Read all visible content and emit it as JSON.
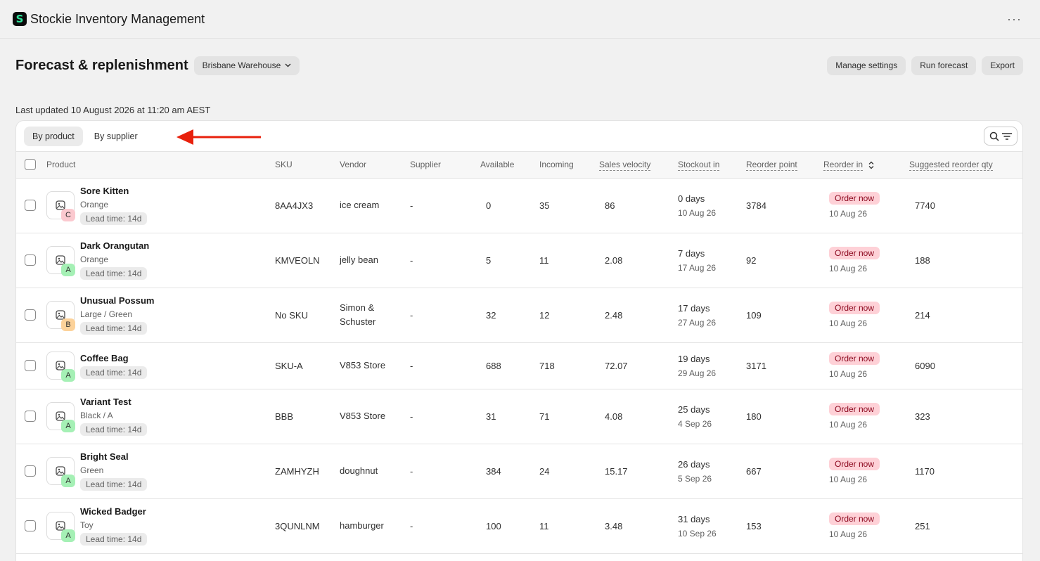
{
  "app": {
    "title": "Stockie Inventory Management",
    "logo_letter": "S",
    "more_label": "···"
  },
  "header": {
    "title": "Forecast & replenishment",
    "location": "Brisbane Warehouse",
    "actions": {
      "manage": "Manage settings",
      "run": "Run forecast",
      "export": "Export"
    }
  },
  "last_updated": "Last updated 10 August 2026 at 11:20 am AEST",
  "tabs": {
    "by_product": "By product",
    "by_supplier": "By supplier"
  },
  "columns": {
    "product": "Product",
    "sku": "SKU",
    "vendor": "Vendor",
    "supplier": "Supplier",
    "available": "Available",
    "incoming": "Incoming",
    "sales_velocity": "Sales velocity",
    "stockout_in": "Stockout in",
    "reorder_point": "Reorder point",
    "reorder_in": "Reorder in",
    "suggested_qty": "Suggested reorder qty"
  },
  "rows": [
    {
      "name": "Sore Kitten",
      "variant": "Orange",
      "lead": "Lead time: 14d",
      "grade": "C",
      "sku": "8AA4JX3",
      "vendor": "ice cream",
      "supplier": "-",
      "available": "0",
      "incoming": "35",
      "velocity": "86",
      "stockout_days": "0 days",
      "stockout_date": "10 Aug 26",
      "reorder_point": "3784",
      "reorder_badge": "Order now",
      "reorder_date": "10 Aug 26",
      "suggested": "7740"
    },
    {
      "name": "Dark Orangutan",
      "variant": "Orange",
      "lead": "Lead time: 14d",
      "grade": "A",
      "sku": "KMVEOLN",
      "vendor": "jelly bean",
      "supplier": "-",
      "available": "5",
      "incoming": "11",
      "velocity": "2.08",
      "stockout_days": "7 days",
      "stockout_date": "17 Aug 26",
      "reorder_point": "92",
      "reorder_badge": "Order now",
      "reorder_date": "10 Aug 26",
      "suggested": "188"
    },
    {
      "name": "Unusual Possum",
      "variant": "Large / Green",
      "lead": "Lead time: 14d",
      "grade": "B",
      "sku": "No SKU",
      "vendor": "Simon & Schuster",
      "supplier": "-",
      "available": "32",
      "incoming": "12",
      "velocity": "2.48",
      "stockout_days": "17 days",
      "stockout_date": "27 Aug 26",
      "reorder_point": "109",
      "reorder_badge": "Order now",
      "reorder_date": "10 Aug 26",
      "suggested": "214"
    },
    {
      "name": "Coffee Bag",
      "variant": "",
      "lead": "Lead time: 14d",
      "grade": "A",
      "sku": "SKU-A",
      "vendor": "V853 Store",
      "supplier": "-",
      "available": "688",
      "incoming": "718",
      "velocity": "72.07",
      "stockout_days": "19 days",
      "stockout_date": "29 Aug 26",
      "reorder_point": "3171",
      "reorder_badge": "Order now",
      "reorder_date": "10 Aug 26",
      "suggested": "6090"
    },
    {
      "name": "Variant Test",
      "variant": "Black / A",
      "lead": "Lead time: 14d",
      "grade": "A",
      "sku": "BBB",
      "vendor": "V853 Store",
      "supplier": "-",
      "available": "31",
      "incoming": "71",
      "velocity": "4.08",
      "stockout_days": "25 days",
      "stockout_date": "4 Sep 26",
      "reorder_point": "180",
      "reorder_badge": "Order now",
      "reorder_date": "10 Aug 26",
      "suggested": "323"
    },
    {
      "name": "Bright Seal",
      "variant": "Green",
      "lead": "Lead time: 14d",
      "grade": "A",
      "sku": "ZAMHYZH",
      "vendor": "doughnut",
      "supplier": "-",
      "available": "384",
      "incoming": "24",
      "velocity": "15.17",
      "stockout_days": "26 days",
      "stockout_date": "5 Sep 26",
      "reorder_point": "667",
      "reorder_badge": "Order now",
      "reorder_date": "10 Aug 26",
      "suggested": "1170"
    },
    {
      "name": "Wicked Badger",
      "variant": "Toy",
      "lead": "Lead time: 14d",
      "grade": "A",
      "sku": "3QUNLNM",
      "vendor": "hamburger",
      "supplier": "-",
      "available": "100",
      "incoming": "11",
      "velocity": "3.48",
      "stockout_days": "31 days",
      "stockout_date": "10 Sep 26",
      "reorder_point": "153",
      "reorder_badge": "Order now",
      "reorder_date": "10 Aug 26",
      "suggested": "251"
    }
  ],
  "colors": {
    "accent_green": "#2fe39b",
    "order_now_bg": "#fed1d7",
    "order_now_text": "#8e0b21",
    "annotation_arrow": "#e8200c"
  }
}
